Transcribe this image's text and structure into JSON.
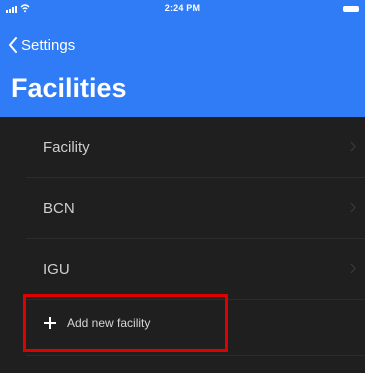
{
  "status_bar": {
    "time": "2:24 PM"
  },
  "nav": {
    "back_label": "Settings",
    "title": "Facilities"
  },
  "list": {
    "items": [
      {
        "label": "Facility"
      },
      {
        "label": "BCN"
      },
      {
        "label": "IGU"
      }
    ],
    "add_label": "Add new facility"
  },
  "colors": {
    "header": "#2f7cf6",
    "background": "#1f1f1f",
    "highlight": "#e00000"
  }
}
